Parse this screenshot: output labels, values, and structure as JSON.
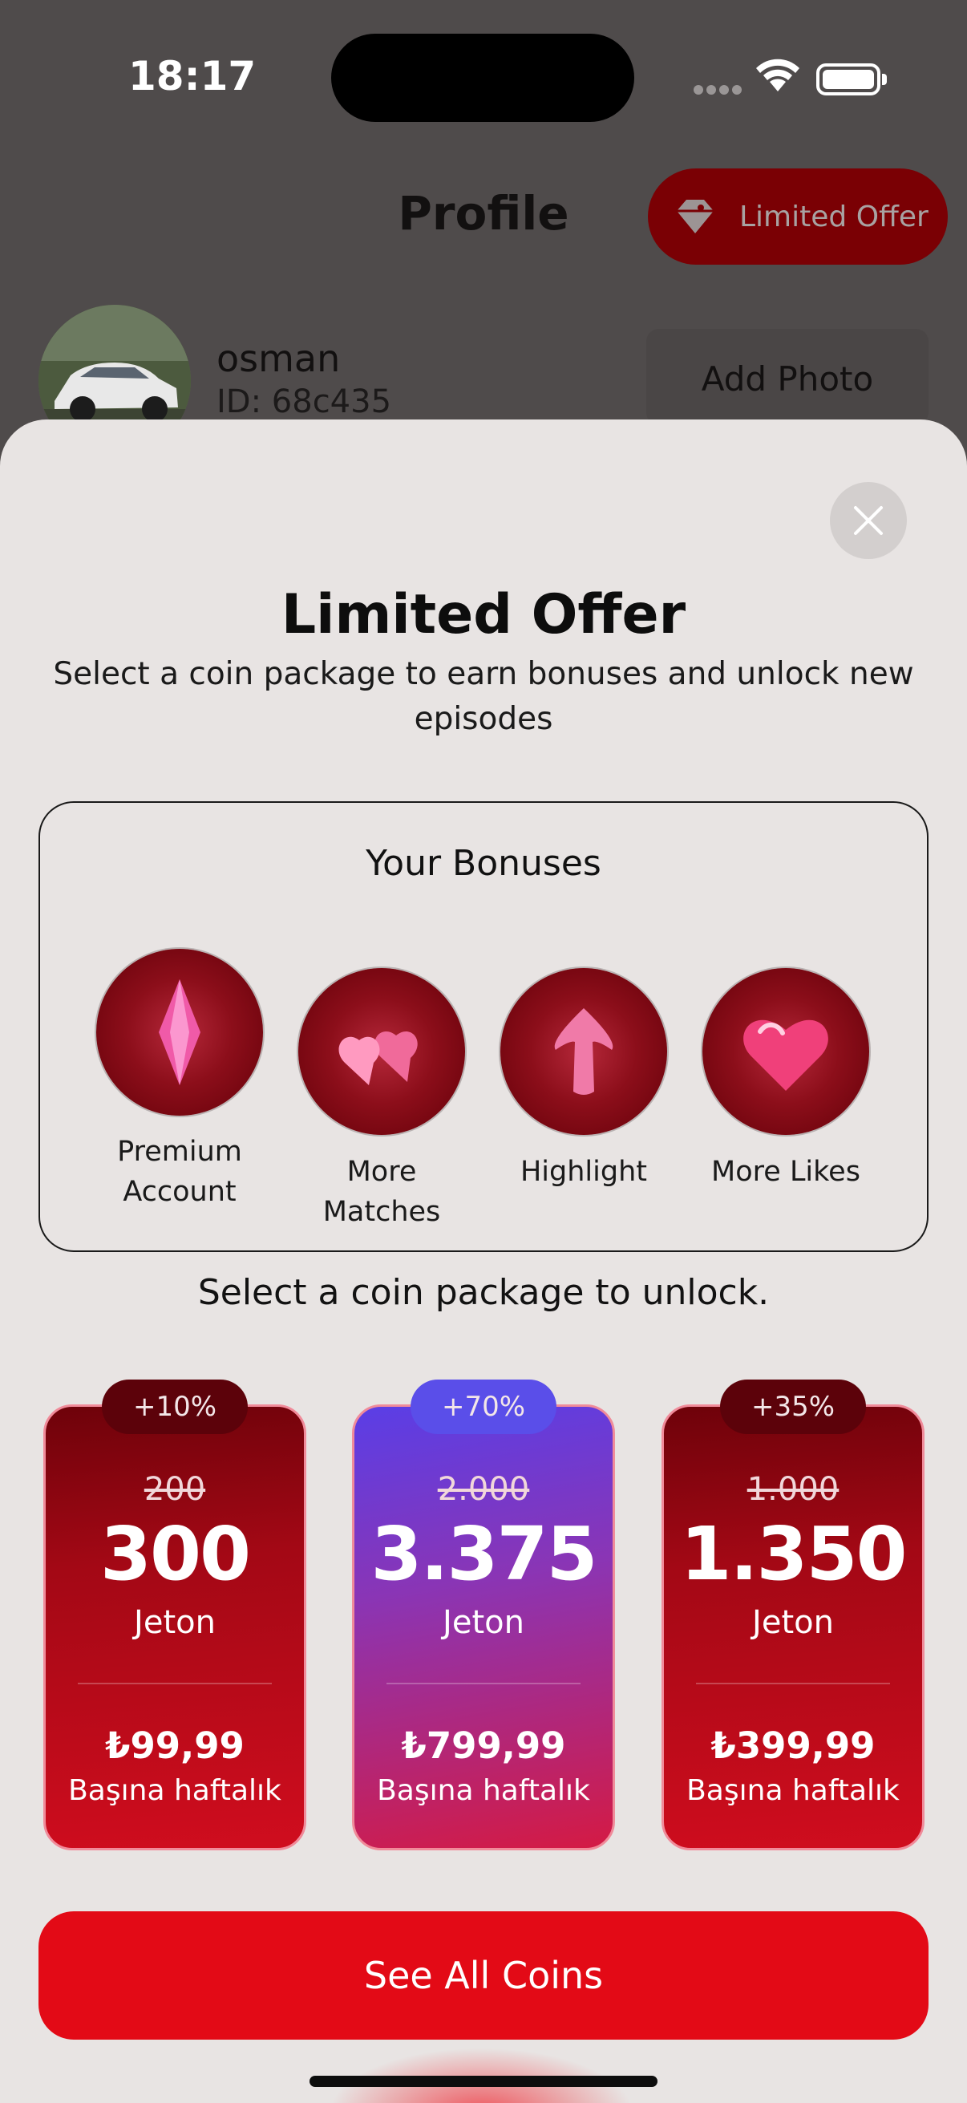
{
  "status_bar": {
    "time": "18:17"
  },
  "header": {
    "title": "Profile",
    "limited_offer_label": "Limited Offer",
    "username": "osman",
    "user_id": "ID: 68c435",
    "add_photo_label": "Add Photo"
  },
  "sheet": {
    "title": "Limited Offer",
    "subtitle": "Select a coin package to earn bonuses and unlock new episodes",
    "bonuses": {
      "title": "Your Bonuses",
      "items": [
        {
          "label": "Premium Account",
          "icon": "diamond-icon"
        },
        {
          "label": "More Matches",
          "icon": "two-hearts-icon"
        },
        {
          "label": "Highlight",
          "icon": "arrow-up-icon"
        },
        {
          "label": "More Likes",
          "icon": "heart-icon"
        }
      ]
    },
    "select_text": "Select a coin package to unlock.",
    "packages": [
      {
        "badge": "+10%",
        "old": "200",
        "coins": "300",
        "unit": "Jeton",
        "price": "₺99,99",
        "period": "Başına haftalık"
      },
      {
        "badge": "+70%",
        "old": "2.000",
        "coins": "3.375",
        "unit": "Jeton",
        "price": "₺799,99",
        "period": "Başına haftalık"
      },
      {
        "badge": "+35%",
        "old": "1.000",
        "coins": "1.350",
        "unit": "Jeton",
        "price": "₺399,99",
        "period": "Başına haftalık"
      }
    ],
    "see_all_label": "See All Coins"
  },
  "colors": {
    "accent_red": "#e30a16",
    "dark_red": "#7a0004",
    "purple": "#5a4ee9",
    "sheet_bg": "#e8e4e3"
  }
}
